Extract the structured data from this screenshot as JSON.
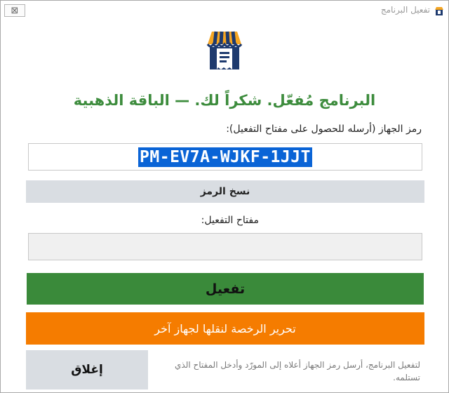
{
  "window": {
    "title": "تفعيل البرنامج",
    "close_glyph": "⊠"
  },
  "status": {
    "text": "البرنامج مُفعّل. شكراً لك.  —  الباقة الذهبية",
    "color": "#3d8c3d"
  },
  "device": {
    "label": "رمز الجهاز (أرسله للحصول على مفتاح التفعيل):",
    "code": "PM-EV7A-WJKF-1JJT",
    "copy_label": "نسخ الرمز"
  },
  "activation": {
    "key_label": "مفتاح التفعيل:",
    "key_value": "",
    "activate_label": "تفعيل",
    "release_label": "تحرير الرخصة لنقلها لجهاز آخر",
    "close_label": "إغلاق"
  },
  "hint": "لتفعيل البرنامج، أرسل رمز الجهاز أعلاه إلى المورّد وأدخل المفتاح الذي تستلمه.",
  "colors": {
    "activate": "#3a8a3a",
    "release": "#f57c00",
    "neutral_button": "#d9dde2",
    "selection": "#0a64d6",
    "logo_blue": "#1e3a6e",
    "logo_orange": "#f5a623"
  },
  "icons": {
    "app": "shop-receipt-icon",
    "title": "shop-receipt-icon",
    "close": "close-icon"
  }
}
